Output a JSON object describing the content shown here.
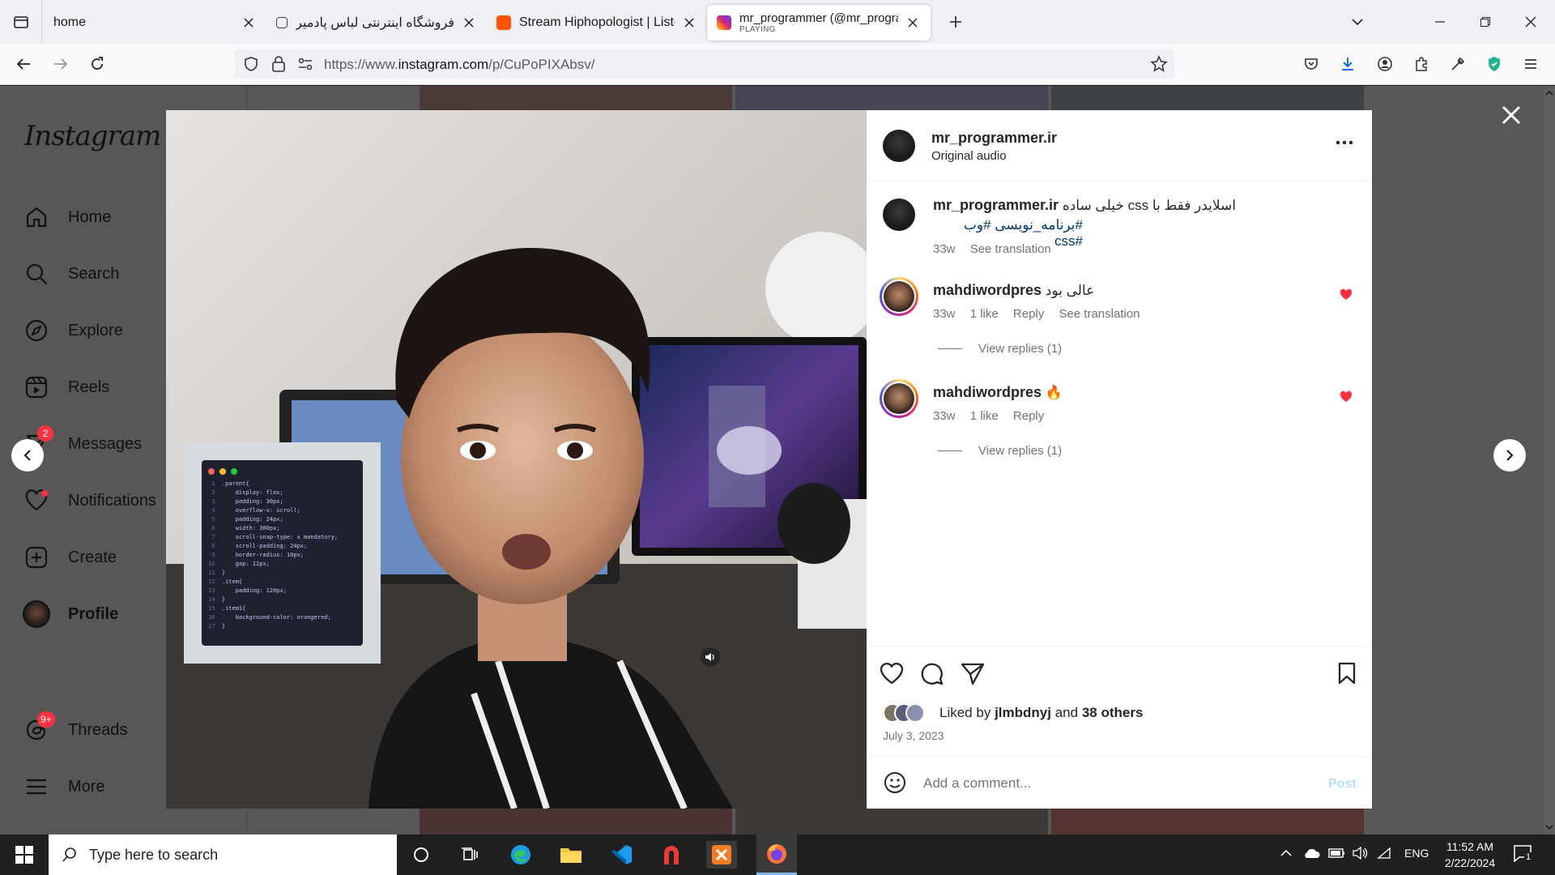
{
  "browser": {
    "tabs": [
      {
        "title": "home",
        "active": false
      },
      {
        "title": "فروشگاه اینترنتی لباس پادمیرا |<",
        "active": false
      },
      {
        "title": "Stream Hiphopologist | Listen t",
        "active": false
      },
      {
        "title": "mr_programmer (@mr_program",
        "subtitle": "PLAYING",
        "active": true
      }
    ],
    "url_prefix": "https://www.",
    "url_domain": "instagram.com",
    "url_path": "/p/CuPoPIXAbsv/"
  },
  "sidebar": {
    "logo": "Instagram",
    "items": [
      {
        "label": "Home",
        "icon": "home-icon"
      },
      {
        "label": "Search",
        "icon": "search-icon"
      },
      {
        "label": "Explore",
        "icon": "compass-icon"
      },
      {
        "label": "Reels",
        "icon": "reels-icon"
      },
      {
        "label": "Messages",
        "icon": "messenger-icon",
        "badge": "2"
      },
      {
        "label": "Notifications",
        "icon": "heart-icon"
      },
      {
        "label": "Create",
        "icon": "plus-square-icon"
      },
      {
        "label": "Profile",
        "icon": "avatar"
      },
      {
        "label": "Threads",
        "icon": "threads-icon",
        "badge": "9+"
      },
      {
        "label": "More",
        "icon": "menu-icon"
      }
    ]
  },
  "post": {
    "author": "mr_programmer.ir",
    "audio": "Original audio",
    "caption_text": "اسلایدر فقط با css خیلی ساده",
    "hashtags": "#برنامه_نویسی #وب #css",
    "caption_age": "33w",
    "see_translation": "See translation",
    "comments": [
      {
        "user": "mahdiwordpres",
        "text": "عالی بود",
        "age": "33w",
        "likes": "1 like",
        "reply": "Reply",
        "translation": "See translation",
        "view_replies": "View replies (1)"
      },
      {
        "user": "mahdiwordpres",
        "text": "🔥",
        "age": "33w",
        "likes": "1 like",
        "reply": "Reply",
        "view_replies": "View replies (1)"
      }
    ],
    "liked_by_prefix": "Liked by",
    "liked_by_user": "jlmbdnyj",
    "liked_by_and": "and",
    "liked_by_others": "38 others",
    "date": "July 3, 2023",
    "comment_placeholder": "Add a comment...",
    "post_button": "Post"
  },
  "code_snippet": [
    ".parent{",
    "    display: flex;",
    "    padding: 30px;",
    "    overflow-x: scroll;",
    "    padding: 24px;",
    "    width: 300px;",
    "    scroll-snap-type: x mandatory;",
    "    scroll-padding: 24px;",
    "    border-radius: 10px;",
    "    gap: 12px;",
    "}",
    ".item{",
    "    padding: 120px;",
    "}",
    ".item1{",
    "    background-color: orangered;",
    "}"
  ],
  "taskbar": {
    "search_placeholder": "Type here to search",
    "language": "ENG",
    "time": "11:52 AM",
    "date": "2/22/2024",
    "notification_count": "1"
  },
  "colors": {
    "like_red": "#ff3040",
    "link_blue": "#00376b",
    "post_button": "#b2dffc"
  }
}
